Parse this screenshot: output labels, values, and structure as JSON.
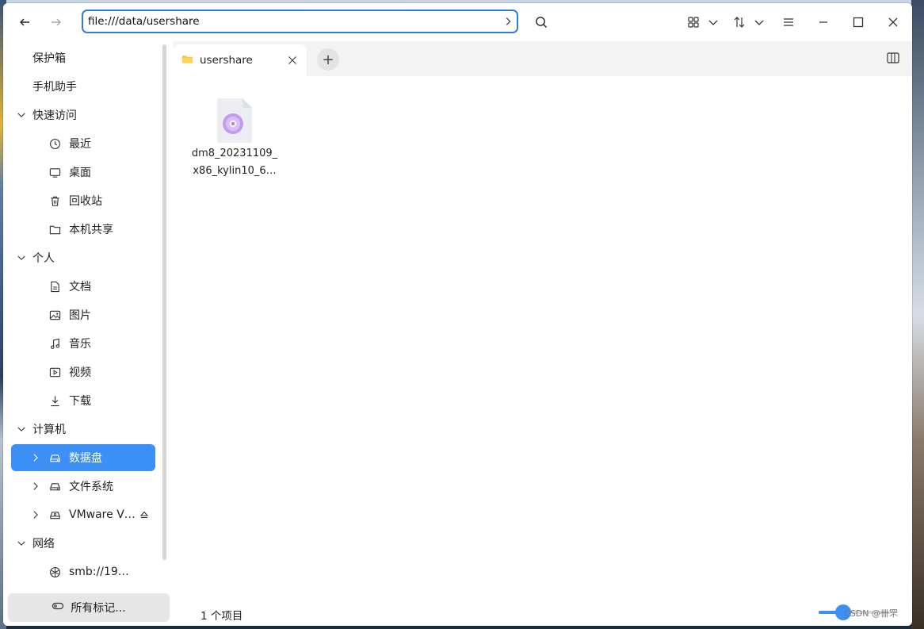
{
  "address": {
    "value": "file:///data/usershare"
  },
  "sidebar": {
    "top": [
      {
        "label": "保护箱"
      },
      {
        "label": "手机助手"
      }
    ],
    "quick_access": {
      "label": "快速访问",
      "items": [
        {
          "label": "最近",
          "icon": "clock-icon"
        },
        {
          "label": "桌面",
          "icon": "monitor-icon"
        },
        {
          "label": "回收站",
          "icon": "trash-icon"
        },
        {
          "label": "本机共享",
          "icon": "folder-icon"
        }
      ]
    },
    "personal": {
      "label": "个人",
      "items": [
        {
          "label": "文档",
          "icon": "document-icon"
        },
        {
          "label": "图片",
          "icon": "image-icon"
        },
        {
          "label": "音乐",
          "icon": "music-icon"
        },
        {
          "label": "视频",
          "icon": "video-icon"
        },
        {
          "label": "下载",
          "icon": "download-icon"
        }
      ]
    },
    "computer": {
      "label": "计算机",
      "items": [
        {
          "label": "数据盘",
          "icon": "drive-icon",
          "active": true
        },
        {
          "label": "文件系统",
          "icon": "drive-icon"
        },
        {
          "label": "VMware V…",
          "icon": "optical-drive-icon"
        }
      ]
    },
    "network": {
      "label": "网络",
      "items": [
        {
          "label": "smb://19…",
          "icon": "network-icon"
        }
      ]
    },
    "tags_button": "所有标记..."
  },
  "tabs": [
    {
      "label": "usershare"
    }
  ],
  "files": [
    {
      "name_line1": "dm8_20231109_",
      "name_line2": "x86_kylin10_6…",
      "icon": "disc-image-icon"
    }
  ],
  "status": {
    "count": "1 个项目"
  },
  "zoom": {
    "level": 0.3
  },
  "watermark": "CSDN @卌罘",
  "colors": {
    "accent": "#3b8ff5",
    "address_border": "#2f7de1"
  }
}
